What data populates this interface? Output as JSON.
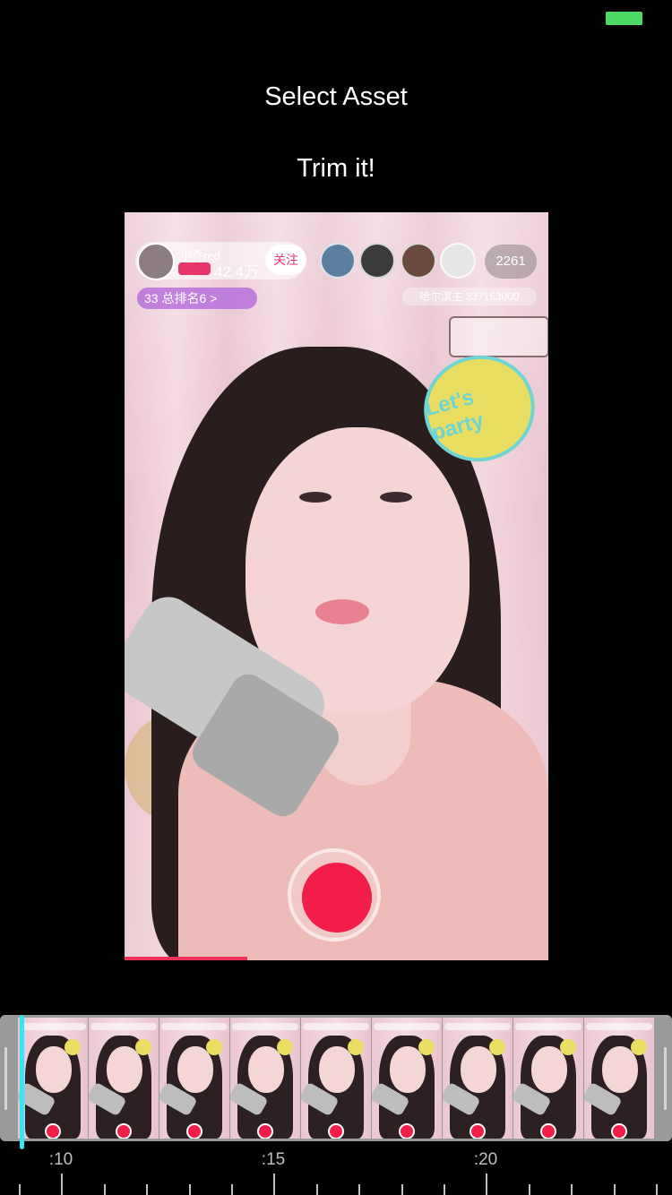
{
  "status_bar": {
    "battery_color": "#4cd964"
  },
  "buttons": {
    "select_asset": "Select Asset",
    "trim_it": "Trim it!"
  },
  "video": {
    "streamer_name": "小乔red",
    "fan_count": "42.4万",
    "follow_label": "关注",
    "viewer_count": "2261",
    "rank_label": "33 总排名6 >",
    "host_id": "哈尔滨主 337153000",
    "sticker_text": "Let's party",
    "record_color": "#f21d48"
  },
  "trimmer": {
    "playhead_color": "#34e7f0",
    "frames": 9
  },
  "ruler": {
    "labels": [
      ":10",
      ":15",
      ":20"
    ]
  }
}
